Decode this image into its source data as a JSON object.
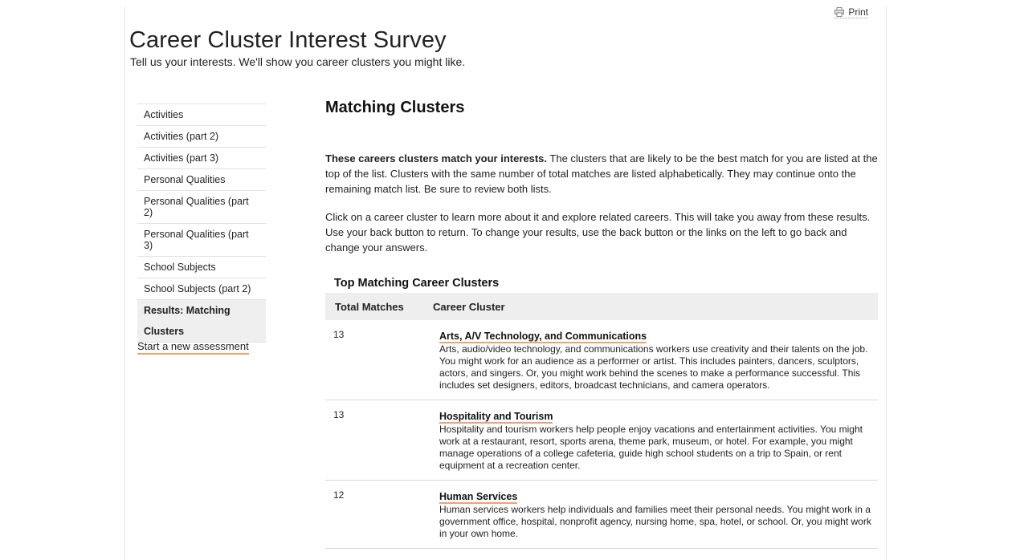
{
  "header": {
    "print_label": "Print",
    "title": "Career Cluster Interest Survey",
    "subtitle": "Tell us your interests. We'll show you career clusters you might like."
  },
  "sidebar": {
    "items": [
      {
        "label": "Activities",
        "active": false
      },
      {
        "label": "Activities (part 2)",
        "active": false
      },
      {
        "label": "Activities (part 3)",
        "active": false
      },
      {
        "label": "Personal Qualities",
        "active": false
      },
      {
        "label": "Personal Qualities (part 2)",
        "active": false
      },
      {
        "label": "Personal Qualities (part 3)",
        "active": false
      },
      {
        "label": "School Subjects",
        "active": false
      },
      {
        "label": "School Subjects (part 2)",
        "active": false
      },
      {
        "label": "Results: Matching Clusters",
        "active": true
      }
    ],
    "start_link": "Start a new assessment"
  },
  "main": {
    "heading": "Matching Clusters",
    "intro_bold": "These careers clusters match your interests.",
    "intro_rest": " The clusters that are likely to be the best match for you are listed at the top of the list. Clusters with the same number of total matches are listed alphabetically. They may continue onto the remaining match list. Be sure to review both lists.",
    "instructions": "Click on a career cluster to learn more about it and explore related careers. This will take you away from these results. Use your back button to return. To change your results, use the back button or the links on the left to go back and change your answers."
  },
  "table": {
    "title": "Top Matching Career Clusters",
    "headers": [
      "Total Matches",
      "Career Cluster"
    ],
    "rows": [
      {
        "matches": "13",
        "cluster": "Arts, A/V Technology, and Communications",
        "description": "Arts, audio/video technology, and communications workers use creativity and their talents on the job. You might work for an audience as a performer or artist. This includes painters, dancers, sculptors, actors, and singers. Or, you might work behind the scenes to make a performance successful. This includes set designers, editors, broadcast technicians, and camera operators."
      },
      {
        "matches": "13",
        "cluster": "Hospitality and Tourism",
        "description": "Hospitality and tourism workers help people enjoy vacations and entertainment activities. You might work at a restaurant, resort, sports arena, theme park, museum, or hotel. For example, you might manage operations of a college cafeteria, guide high school students on a trip to Spain, or rent equipment at a recreation center."
      },
      {
        "matches": "12",
        "cluster": "Human Services",
        "description": "Human services workers help individuals and families meet their personal needs. You might work in a government office, hospital, nonprofit agency, nursing home, spa, hotel, or school. Or, you might work in your own home."
      }
    ]
  },
  "colors": {
    "link_underline": "#f0a36a",
    "header_bg": "#eeeeee",
    "active_bg": "#efefef"
  }
}
